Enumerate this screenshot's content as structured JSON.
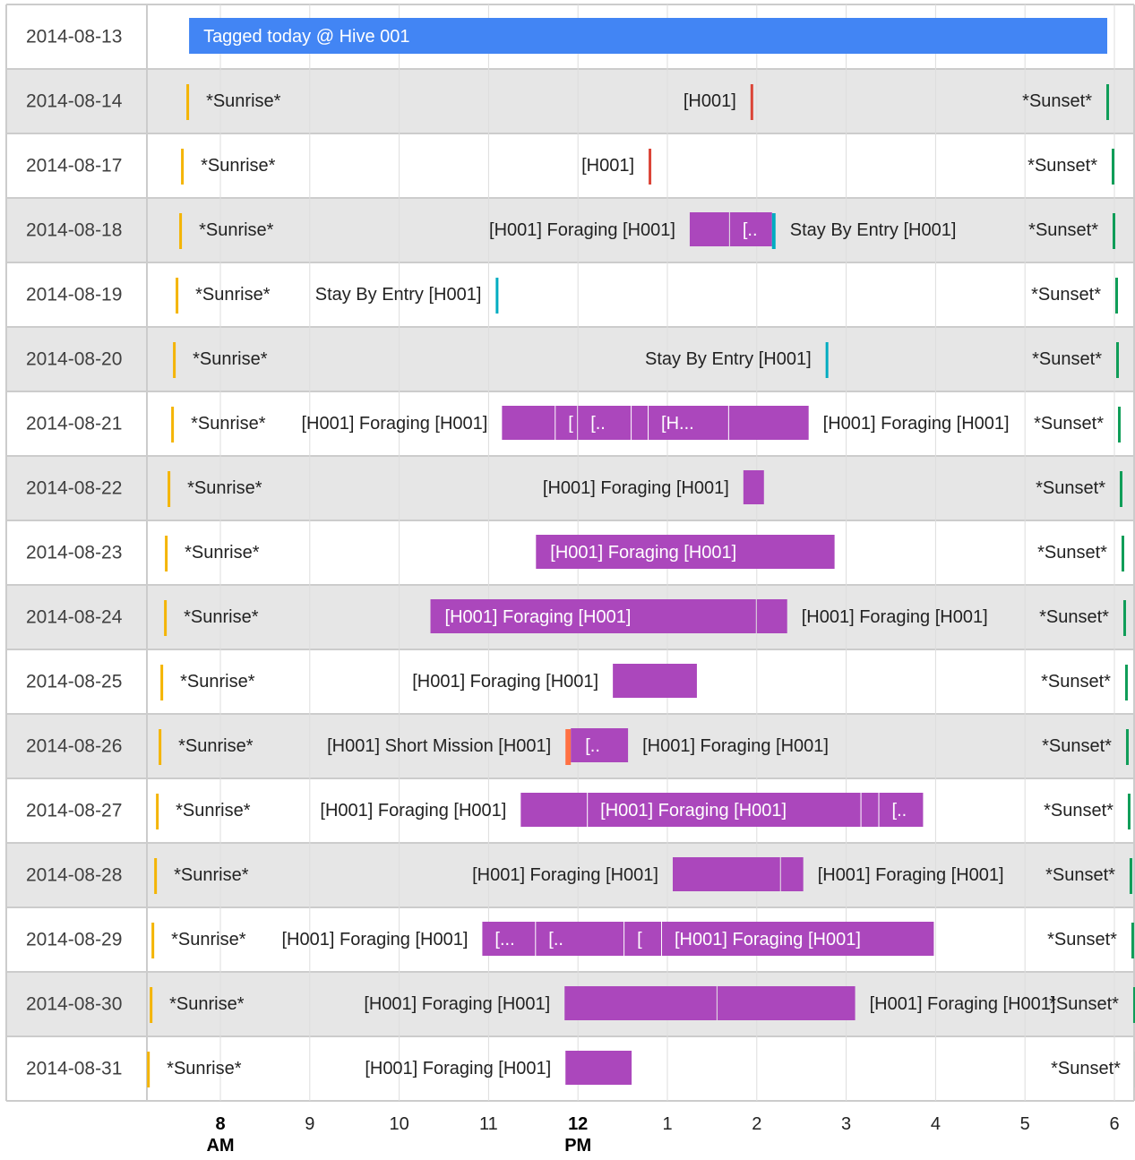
{
  "colors": {
    "tagged": "#4285f4",
    "sunrise": "#f4b400",
    "sunset": "#0f9d58",
    "marker_red": "#db4437",
    "stay_by_entry": "#00acc1",
    "foraging": "#ab47bc",
    "short_mission": "#ff7043"
  },
  "chart_data": {
    "type": "timeline",
    "x_axis": {
      "range_hours": [
        6.4,
        18.25
      ],
      "ticks": [
        {
          "hour": 8,
          "label": "8",
          "sub": "AM",
          "bold": true
        },
        {
          "hour": 9,
          "label": "9",
          "sub": "",
          "bold": false
        },
        {
          "hour": 10,
          "label": "10",
          "sub": "",
          "bold": false
        },
        {
          "hour": 11,
          "label": "11",
          "sub": "",
          "bold": false
        },
        {
          "hour": 12,
          "label": "12",
          "sub": "PM",
          "bold": true
        },
        {
          "hour": 13,
          "label": "1",
          "sub": "",
          "bold": false
        },
        {
          "hour": 14,
          "label": "2",
          "sub": "",
          "bold": false
        },
        {
          "hour": 15,
          "label": "3",
          "sub": "",
          "bold": false
        },
        {
          "hour": 16,
          "label": "4",
          "sub": "",
          "bold": false
        },
        {
          "hour": 17,
          "label": "5",
          "sub": "",
          "bold": false
        },
        {
          "hour": 18,
          "label": "6",
          "sub": "",
          "bold": false
        }
      ]
    },
    "rows": [
      {
        "date": "2014-08-13",
        "items": [
          {
            "start": 7.65,
            "end": 17.92,
            "color": "tagged",
            "label": "Tagged today @ Hive 001",
            "label_pos": "inside"
          }
        ]
      },
      {
        "date": "2014-08-14",
        "items": [
          {
            "start": 7.62,
            "end": 7.65,
            "color": "sunrise",
            "label": "*Sunrise*",
            "label_pos": "right"
          },
          {
            "start": 13.93,
            "end": 13.96,
            "color": "marker_red",
            "label": "[H001]",
            "label_pos": "left"
          },
          {
            "start": 17.91,
            "end": 17.94,
            "color": "sunset",
            "label": "*Sunset*",
            "label_pos": "left"
          }
        ]
      },
      {
        "date": "2014-08-17",
        "items": [
          {
            "start": 7.56,
            "end": 7.59,
            "color": "sunrise",
            "label": "*Sunrise*",
            "label_pos": "right"
          },
          {
            "start": 12.79,
            "end": 12.82,
            "color": "marker_red",
            "label": "[H001]",
            "label_pos": "left"
          },
          {
            "start": 17.97,
            "end": 17.98,
            "color": "sunset",
            "label": "*Sunset*",
            "label_pos": "left"
          }
        ]
      },
      {
        "date": "2014-08-18",
        "items": [
          {
            "start": 7.54,
            "end": 7.57,
            "color": "sunrise",
            "label": "*Sunrise*",
            "label_pos": "right"
          },
          {
            "start": 13.25,
            "end": 14.17,
            "color": "foraging",
            "label": "[H001] Foraging [H001]",
            "label_pos": "left",
            "segments": [
              {
                "start": 13.25,
                "end": 13.69,
                "label": ""
              },
              {
                "start": 13.7,
                "end": 14.17,
                "label": "[.."
              }
            ]
          },
          {
            "start": 14.17,
            "end": 14.21,
            "color": "stay_by_entry",
            "label": "Stay By Entry [H001]",
            "label_pos": "right"
          },
          {
            "start": 17.98,
            "end": 18.01,
            "color": "sunset",
            "label": "*Sunset*",
            "label_pos": "left"
          }
        ]
      },
      {
        "date": "2014-08-19",
        "items": [
          {
            "start": 7.5,
            "end": 7.53,
            "color": "sunrise",
            "label": "*Sunrise*",
            "label_pos": "right"
          },
          {
            "start": 11.08,
            "end": 11.11,
            "color": "stay_by_entry",
            "label": "Stay By Entry [H001]",
            "label_pos": "left"
          },
          {
            "start": 18.01,
            "end": 18.02,
            "color": "sunset",
            "label": "*Sunset*",
            "label_pos": "left"
          }
        ]
      },
      {
        "date": "2014-08-20",
        "items": [
          {
            "start": 7.47,
            "end": 7.5,
            "color": "sunrise",
            "label": "*Sunrise*",
            "label_pos": "right"
          },
          {
            "start": 14.77,
            "end": 14.8,
            "color": "stay_by_entry",
            "label": "Stay By Entry [H001]",
            "label_pos": "left"
          },
          {
            "start": 18.02,
            "end": 18.05,
            "color": "sunset",
            "label": "*Sunset*",
            "label_pos": "left"
          }
        ]
      },
      {
        "date": "2014-08-21",
        "items": [
          {
            "start": 7.45,
            "end": 7.48,
            "color": "sunrise",
            "label": "*Sunrise*",
            "label_pos": "right"
          },
          {
            "start": 11.15,
            "end": 14.58,
            "color": "foraging",
            "label": "[H001] Foraging [H001]",
            "label_pos": "left",
            "segments": [
              {
                "start": 11.15,
                "end": 11.74,
                "label": ""
              },
              {
                "start": 11.75,
                "end": 11.99,
                "label": "["
              },
              {
                "start": 12.0,
                "end": 12.59,
                "label": "[.."
              },
              {
                "start": 12.6,
                "end": 12.78,
                "label": ""
              },
              {
                "start": 12.79,
                "end": 13.68,
                "label": "[H..."
              },
              {
                "start": 13.69,
                "end": 14.58,
                "label": ""
              }
            ]
          },
          {
            "start": 14.58,
            "end": 14.58,
            "color": "foraging",
            "label": "[H001] Foraging [H001]",
            "label_pos": "right",
            "hidden": true
          },
          {
            "start": 18.04,
            "end": 18.07,
            "color": "sunset",
            "label": "*Sunset*",
            "label_pos": "left"
          }
        ]
      },
      {
        "date": "2014-08-22",
        "items": [
          {
            "start": 7.41,
            "end": 7.44,
            "color": "sunrise",
            "label": "*Sunrise*",
            "label_pos": "right"
          },
          {
            "start": 13.85,
            "end": 14.08,
            "color": "foraging",
            "label": "[H001] Foraging [H001]",
            "label_pos": "left"
          },
          {
            "start": 18.06,
            "end": 18.09,
            "color": "sunset",
            "label": "*Sunset*",
            "label_pos": "left"
          }
        ]
      },
      {
        "date": "2014-08-23",
        "items": [
          {
            "start": 7.38,
            "end": 7.41,
            "color": "sunrise",
            "label": "*Sunrise*",
            "label_pos": "right"
          },
          {
            "start": 11.53,
            "end": 14.87,
            "color": "foraging",
            "label": "[H001] Foraging [H001]",
            "label_pos": "inside"
          },
          {
            "start": 18.08,
            "end": 18.11,
            "color": "sunset",
            "label": "*Sunset*",
            "label_pos": "left"
          }
        ]
      },
      {
        "date": "2014-08-24",
        "items": [
          {
            "start": 7.37,
            "end": 7.4,
            "color": "sunrise",
            "label": "*Sunrise*",
            "label_pos": "right"
          },
          {
            "start": 10.35,
            "end": 13.99,
            "color": "foraging",
            "label": "[H001] Foraging [H001]",
            "label_pos": "inside"
          },
          {
            "start": 14.0,
            "end": 14.34,
            "color": "foraging",
            "label": "[H001] Foraging [H001]",
            "label_pos": "right"
          },
          {
            "start": 18.1,
            "end": 18.13,
            "color": "sunset",
            "label": "*Sunset*",
            "label_pos": "left"
          }
        ]
      },
      {
        "date": "2014-08-25",
        "items": [
          {
            "start": 7.33,
            "end": 7.36,
            "color": "sunrise",
            "label": "*Sunrise*",
            "label_pos": "right"
          },
          {
            "start": 12.39,
            "end": 13.33,
            "color": "foraging",
            "label": "[H001] Foraging [H001]",
            "label_pos": "left"
          },
          {
            "start": 18.12,
            "end": 18.15,
            "color": "sunset",
            "label": "*Sunset*",
            "label_pos": "left"
          }
        ]
      },
      {
        "date": "2014-08-26",
        "items": [
          {
            "start": 7.31,
            "end": 7.34,
            "color": "sunrise",
            "label": "*Sunrise*",
            "label_pos": "right"
          },
          {
            "start": 11.86,
            "end": 11.92,
            "color": "short_mission",
            "label": "[H001] Short Mission [H001]",
            "label_pos": "left"
          },
          {
            "start": 11.92,
            "end": 12.56,
            "color": "foraging",
            "label": "[..",
            "label_pos": "inside",
            "label2": "[H001] Foraging [H001]"
          },
          {
            "start": 18.13,
            "end": 18.16,
            "color": "sunset",
            "label": "*Sunset*",
            "label_pos": "left"
          }
        ]
      },
      {
        "date": "2014-08-27",
        "items": [
          {
            "start": 7.28,
            "end": 7.31,
            "color": "sunrise",
            "label": "*Sunrise*",
            "label_pos": "right"
          },
          {
            "start": 11.36,
            "end": 15.86,
            "color": "foraging",
            "label": "[H001] Foraging [H001]",
            "label_pos": "left",
            "segments": [
              {
                "start": 11.36,
                "end": 12.1,
                "label": ""
              },
              {
                "start": 12.11,
                "end": 15.16,
                "label": "[H001] Foraging [H001]"
              },
              {
                "start": 15.17,
                "end": 15.36,
                "label": ""
              },
              {
                "start": 15.37,
                "end": 15.86,
                "label": "[.."
              }
            ]
          },
          {
            "start": 18.15,
            "end": 18.18,
            "color": "sunset",
            "label": "*Sunset*",
            "label_pos": "left"
          }
        ]
      },
      {
        "date": "2014-08-28",
        "items": [
          {
            "start": 7.26,
            "end": 7.29,
            "color": "sunrise",
            "label": "*Sunrise*",
            "label_pos": "right"
          },
          {
            "start": 13.06,
            "end": 14.52,
            "color": "foraging",
            "label": "[H001] Foraging [H001]",
            "label_pos": "left",
            "segments": [
              {
                "start": 13.06,
                "end": 14.26,
                "label": ""
              },
              {
                "start": 14.27,
                "end": 14.52,
                "label": ""
              }
            ]
          },
          {
            "start": 14.52,
            "end": 14.52,
            "color": "foraging",
            "label": "[H001] Foraging [H001]",
            "label_pos": "right",
            "hidden": true
          },
          {
            "start": 18.17,
            "end": 18.2,
            "color": "sunset",
            "label": "*Sunset*",
            "label_pos": "left"
          }
        ]
      },
      {
        "date": "2014-08-29",
        "items": [
          {
            "start": 7.23,
            "end": 7.26,
            "color": "sunrise",
            "label": "*Sunrise*",
            "label_pos": "right"
          },
          {
            "start": 10.93,
            "end": 15.98,
            "color": "foraging",
            "label": "[H001] Foraging [H001]",
            "label_pos": "left",
            "segments": [
              {
                "start": 10.93,
                "end": 11.52,
                "label": "[..."
              },
              {
                "start": 11.53,
                "end": 12.51,
                "label": "[.."
              },
              {
                "start": 12.52,
                "end": 12.93,
                "label": "["
              },
              {
                "start": 12.94,
                "end": 15.98,
                "label": "[H001] Foraging [H001]"
              }
            ]
          },
          {
            "start": 18.19,
            "end": 18.22,
            "color": "sunset",
            "label": "*Sunset*",
            "label_pos": "left"
          }
        ]
      },
      {
        "date": "2014-08-30",
        "items": [
          {
            "start": 7.21,
            "end": 7.24,
            "color": "sunrise",
            "label": "*Sunrise*",
            "label_pos": "right"
          },
          {
            "start": 11.85,
            "end": 15.1,
            "color": "foraging",
            "label": "[H001] Foraging [H001]",
            "label_pos": "left",
            "segments": [
              {
                "start": 11.85,
                "end": 13.55,
                "label": ""
              },
              {
                "start": 13.56,
                "end": 15.1,
                "label": ""
              }
            ]
          },
          {
            "start": 15.1,
            "end": 15.1,
            "color": "foraging",
            "label": "[H001] Foraging [H001]",
            "label_pos": "right",
            "hidden": true
          },
          {
            "start": 18.21,
            "end": 18.24,
            "color": "sunset",
            "label": "*Sunset*",
            "label_pos": "left"
          }
        ]
      },
      {
        "date": "2014-08-31",
        "items": [
          {
            "start": 7.18,
            "end": 7.21,
            "color": "sunrise",
            "label": "*Sunrise*",
            "label_pos": "right"
          },
          {
            "start": 11.86,
            "end": 12.6,
            "color": "foraging",
            "label": "[H001] Foraging [H001]",
            "label_pos": "left"
          },
          {
            "start": 18.23,
            "end": 18.25,
            "color": "sunset",
            "label": "*Sunset*",
            "label_pos": "left"
          }
        ]
      }
    ]
  }
}
